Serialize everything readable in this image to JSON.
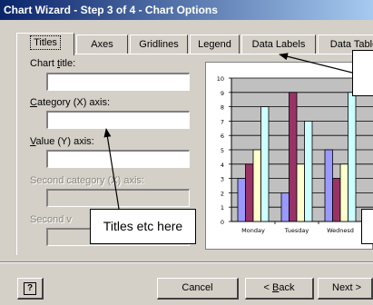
{
  "window": {
    "title": "Chart Wizard - Step 3 of 4 - Chart Options"
  },
  "tabs": [
    {
      "label": "Titles",
      "active": true
    },
    {
      "label": "Axes",
      "active": false
    },
    {
      "label": "Gridlines",
      "active": false
    },
    {
      "label": "Legend",
      "active": false
    },
    {
      "label": "Data Labels",
      "active": false
    },
    {
      "label": "Data Table",
      "active": false
    }
  ],
  "form": {
    "chart_title": {
      "pre": "Chart ",
      "hot": "t",
      "post": "itle:",
      "value": ""
    },
    "category_axis": {
      "pre": "",
      "hot": "C",
      "post": "ategory (X) axis:",
      "value": ""
    },
    "value_axis": {
      "pre": "",
      "hot": "V",
      "post": "alue (Y) axis:",
      "value": ""
    },
    "second_category_axis": {
      "label": "Second category (X) axis:"
    },
    "second_value_axis": {
      "label": "Second v"
    }
  },
  "annotation": {
    "text": "Titles etc here"
  },
  "chart_data": {
    "type": "bar",
    "categories": [
      "Monday",
      "Tuesday",
      "Wednesd"
    ],
    "series": [
      {
        "values": [
          3,
          2,
          5
        ],
        "color": "#9999ff"
      },
      {
        "values": [
          4,
          9,
          3
        ],
        "color": "#993366"
      },
      {
        "values": [
          5,
          4,
          4
        ],
        "color": "#ffffcc"
      },
      {
        "values": [
          8,
          7,
          9
        ],
        "color": "#ccffff"
      }
    ],
    "ylim": [
      0,
      10
    ],
    "yticks": [
      "0",
      "1",
      "2",
      "3",
      "4",
      "5",
      "6",
      "7",
      "8",
      "9",
      "10"
    ],
    "grid": true,
    "plot_background": "#c0c0c0"
  },
  "buttons": {
    "help_icon": "?",
    "cancel": "Cancel",
    "back": {
      "pre": "< ",
      "hot": "B",
      "post": "ack"
    },
    "next": "Next >"
  }
}
